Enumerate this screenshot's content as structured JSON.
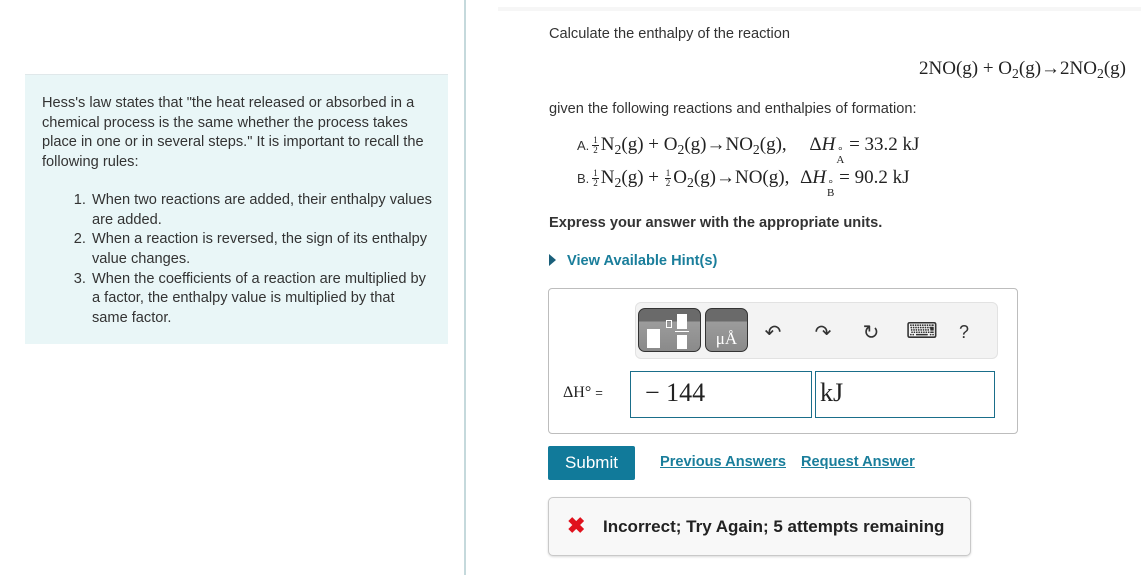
{
  "intro": {
    "paragraph": "Hess's law states that \"the heat released or absorbed in a chemical process is the same whether the process takes place in one or in several steps.\" It is important to recall the following rules:",
    "rules": [
      "When two reactions are added, their enthalpy values are added.",
      "When a reaction is reversed, the sign of its enthalpy value changes.",
      "When the coefficients of a reaction are multiplied by a factor, the enthalpy value is multiplied by that same factor."
    ]
  },
  "question": {
    "prompt": "Calculate the enthalpy of the reaction",
    "target_reaction": {
      "r1_coef": "2NO(g) + O",
      "r1_sub": "2",
      "r1_end": "(g)→2NO",
      "p_sub": "2",
      "p_end": "(g)"
    },
    "given_text": "given the following reactions and enthalpies of formation:",
    "reactions": [
      {
        "label": "A.",
        "frac": [
          "1",
          "2"
        ],
        "part1": "N",
        "sub1": "2",
        "part2": "(g) + O",
        "sub2": "2",
        "part3": "(g)→NO",
        "sub3": "2",
        "part4": "(g),",
        "dh_sub": "A",
        "dh_value": "= 33.2 kJ"
      },
      {
        "label": "B.",
        "frac": [
          "1",
          "2"
        ],
        "part1": "N",
        "sub1": "2",
        "part2": "(g) + ",
        "frac2": [
          "1",
          "2"
        ],
        "part2b": "O",
        "sub2": "2",
        "part3": "(g)→NO(g),",
        "dh_sub": "B",
        "dh_value": "= 90.2 kJ"
      }
    ],
    "instruction": "Express your answer with the appropriate units.",
    "hint_link": "View Available Hint(s)"
  },
  "answer": {
    "toolbar": {
      "units_button": "μÅ",
      "undo": "↶",
      "redo": "↷",
      "reset": "↻",
      "keyboard": "⌨",
      "help": "?"
    },
    "label_symbol": "ΔH°",
    "label_eq": "=",
    "value": "− 144",
    "unit": "kJ"
  },
  "actions": {
    "submit": "Submit",
    "previous_answers": "Previous Answers",
    "request_answer": "Request Answer"
  },
  "feedback": {
    "icon": "✖",
    "message": "Incorrect; Try Again; 5 attempts remaining",
    "color": "#e0121d"
  }
}
